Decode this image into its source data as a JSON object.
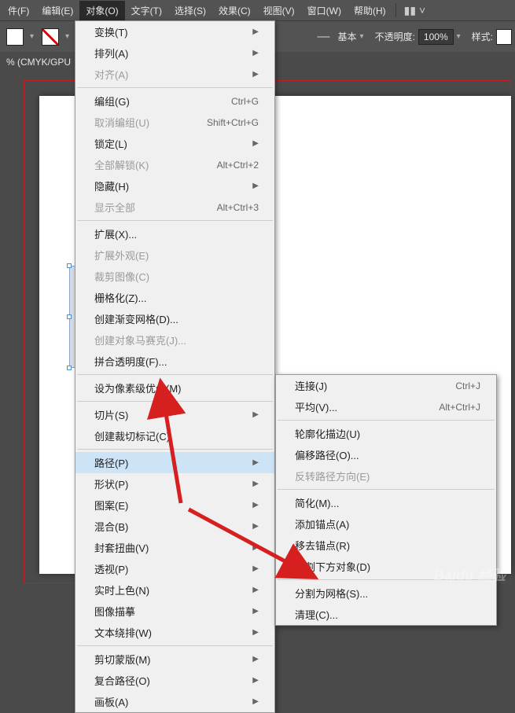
{
  "menubar": {
    "items": [
      "件(F)",
      "编辑(E)",
      "对象(O)",
      "文字(T)",
      "选择(S)",
      "效果(C)",
      "视图(V)",
      "窗口(W)",
      "帮助(H)"
    ]
  },
  "toolbar": {
    "basic": "基本",
    "opacity_label": "不透明度:",
    "opacity_value": "100%",
    "style_label": "样式:"
  },
  "docinfo": "% (CMYK/GPU",
  "menu1": {
    "items": [
      {
        "t": "变换(T)",
        "arrow": true
      },
      {
        "t": "排列(A)",
        "arrow": true
      },
      {
        "t": "对齐(A)",
        "arrow": true,
        "disabled": true
      },
      {
        "sep": true
      },
      {
        "t": "编组(G)",
        "sc": "Ctrl+G"
      },
      {
        "t": "取消编组(U)",
        "sc": "Shift+Ctrl+G",
        "disabled": true
      },
      {
        "t": "锁定(L)",
        "arrow": true
      },
      {
        "t": "全部解锁(K)",
        "sc": "Alt+Ctrl+2",
        "disabled": true
      },
      {
        "t": "隐藏(H)",
        "arrow": true
      },
      {
        "t": "显示全部",
        "sc": "Alt+Ctrl+3",
        "disabled": true
      },
      {
        "sep": true
      },
      {
        "t": "扩展(X)..."
      },
      {
        "t": "扩展外观(E)",
        "disabled": true
      },
      {
        "t": "裁剪图像(C)",
        "disabled": true
      },
      {
        "t": "栅格化(Z)..."
      },
      {
        "t": "创建渐变网格(D)..."
      },
      {
        "t": "创建对象马赛克(J)...",
        "disabled": true
      },
      {
        "t": "拼合透明度(F)..."
      },
      {
        "sep": true
      },
      {
        "t": "设为像素级优化(M)"
      },
      {
        "sep": true
      },
      {
        "t": "切片(S)",
        "arrow": true
      },
      {
        "t": "创建裁切标记(C)"
      },
      {
        "sep": true
      },
      {
        "t": "路径(P)",
        "arrow": true,
        "hl": true
      },
      {
        "t": "形状(P)",
        "arrow": true
      },
      {
        "t": "图案(E)",
        "arrow": true
      },
      {
        "t": "混合(B)",
        "arrow": true
      },
      {
        "t": "封套扭曲(V)",
        "arrow": true
      },
      {
        "t": "透视(P)",
        "arrow": true
      },
      {
        "t": "实时上色(N)",
        "arrow": true
      },
      {
        "t": "图像描摹",
        "arrow": true
      },
      {
        "t": "文本绕排(W)",
        "arrow": true
      },
      {
        "sep": true
      },
      {
        "t": "剪切蒙版(M)",
        "arrow": true
      },
      {
        "t": "复合路径(O)",
        "arrow": true
      },
      {
        "t": "画板(A)",
        "arrow": true
      }
    ]
  },
  "menu2": {
    "items": [
      {
        "t": "连接(J)",
        "sc": "Ctrl+J"
      },
      {
        "t": "平均(V)...",
        "sc": "Alt+Ctrl+J"
      },
      {
        "sep": true
      },
      {
        "t": "轮廓化描边(U)"
      },
      {
        "t": "偏移路径(O)..."
      },
      {
        "t": "反转路径方向(E)",
        "disabled": true
      },
      {
        "sep": true
      },
      {
        "t": "简化(M)..."
      },
      {
        "t": "添加锚点(A)"
      },
      {
        "t": "移去锚点(R)"
      },
      {
        "t": "分割下方对象(D)"
      },
      {
        "sep": true
      },
      {
        "t": "分割为网格(S)..."
      },
      {
        "t": "清理(C)..."
      }
    ]
  },
  "watermark": "Baidu 经验"
}
